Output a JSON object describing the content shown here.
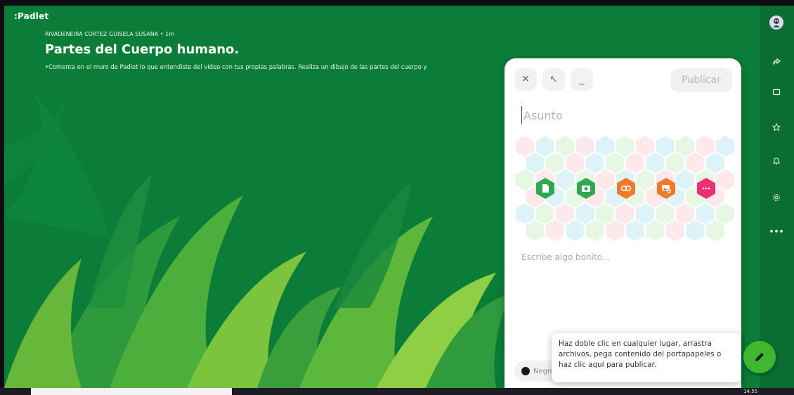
{
  "app": {
    "logo": ":Padlet"
  },
  "post_header": {
    "author_line": "RIVADENEIRA CORTEZ GUISELA SUSANA • 1m",
    "title": "Partes del Cuerpo humano.",
    "description": "•Comenta en el muro de Padlet lo que entendiste del video con tus propias palabras. Realiza un dibujo de las partes del cuerpo y"
  },
  "right_rail": {
    "icons": [
      "avatar-icon",
      "share-icon",
      "slideshow-icon",
      "star-icon",
      "bell-icon",
      "settings-icon",
      "more-icon"
    ],
    "more_label": "•••"
  },
  "composer": {
    "close_glyph": "✕",
    "expand_glyph": "↖",
    "minimize_glyph": "_",
    "publish_label": "Publicar",
    "subject_placeholder": "Asunto",
    "body_placeholder": "Escribe algo bonito...",
    "attachment_icons": [
      {
        "name": "file-upload-icon",
        "color": "#2fa84f"
      },
      {
        "name": "camera-icon",
        "color": "#2fa84f"
      },
      {
        "name": "link-icon",
        "color": "#f07a2a"
      },
      {
        "name": "image-search-icon",
        "color": "#f07a2a"
      },
      {
        "name": "more-attachments-icon",
        "color": "#ea2f73"
      }
    ],
    "color_label": "Negro",
    "color_value": "#1a1a1a"
  },
  "tooltip": {
    "text": "Haz doble clic en cualquier lugar, arrastra archivos, pega contenido del portapapeles o haz clic aquí para publicar."
  },
  "fab": {
    "icon": "pencil-icon",
    "color": "#3fb82f"
  },
  "taskbar": {
    "clock": "14:55"
  },
  "colors": {
    "background_green": "#0c7d38",
    "rail_green": "#0b6d31"
  }
}
